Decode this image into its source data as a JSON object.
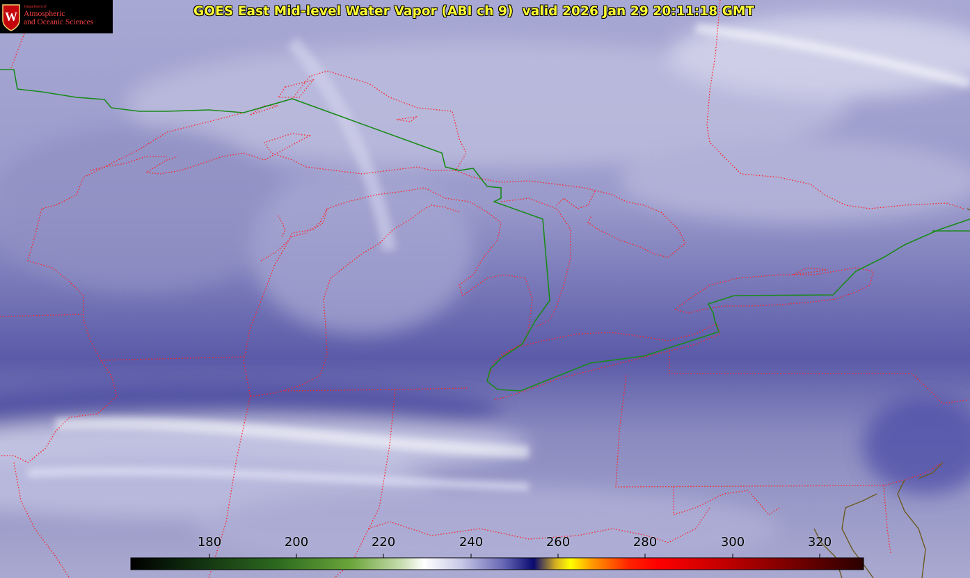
{
  "title": "GOES East Mid-level Water Vapor (ABI ch 9)  valid 2026 Jan 29 20:11:18 GMT",
  "logo": {
    "dept": "Department of",
    "line1": "Atmospheric",
    "line2": "and Oceanic Sciences",
    "seal_letter": "W"
  },
  "colorbar": {
    "ticks": [
      "180",
      "200",
      "220",
      "240",
      "260",
      "280",
      "300",
      "320"
    ]
  },
  "colors": {
    "background": "#8e8ec2",
    "title": "#ffff33",
    "state_borders": "#ff2020",
    "international_border": "#1a8a1a",
    "coastline": "#6b5a1e"
  }
}
